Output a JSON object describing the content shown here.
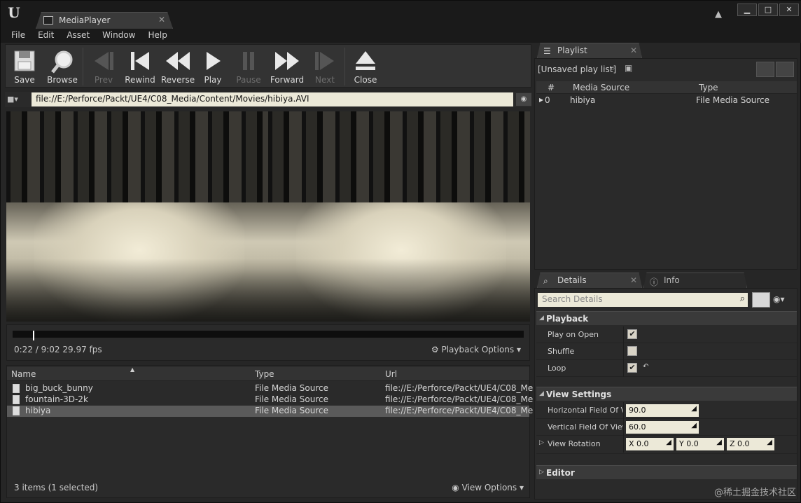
{
  "window": {
    "tab_title": "MediaPlayer"
  },
  "menu": [
    "File",
    "Edit",
    "Asset",
    "Window",
    "Help"
  ],
  "toolbar": {
    "buttons": [
      {
        "label": "Save",
        "enabled": true
      },
      {
        "label": "Browse",
        "enabled": true
      },
      {
        "label": "Prev",
        "enabled": false
      },
      {
        "label": "Rewind",
        "enabled": true
      },
      {
        "label": "Reverse",
        "enabled": true
      },
      {
        "label": "Play",
        "enabled": true
      },
      {
        "label": "Pause",
        "enabled": false
      },
      {
        "label": "Forward",
        "enabled": true
      },
      {
        "label": "Next",
        "enabled": false
      },
      {
        "label": "Close",
        "enabled": true
      }
    ]
  },
  "url": {
    "value": "file://E:/Perforce/Packt/UE4/C08_Media/Content/Movies/hibiya.AVI"
  },
  "playback": {
    "time": "0:22 / 9:02  29.97 fps",
    "progress_fraction": 0.04,
    "options_label": "Playback Options"
  },
  "media_list": {
    "columns": [
      "Name",
      "Type",
      "Url"
    ],
    "rows": [
      {
        "name": "big_buck_bunny",
        "type": "File Media Source",
        "url": "file://E:/Perforce/Packt/UE4/C08_Me",
        "selected": false
      },
      {
        "name": "fountain-3D-2k",
        "type": "File Media Source",
        "url": "file://E:/Perforce/Packt/UE4/C08_Me",
        "selected": false
      },
      {
        "name": "hibiya",
        "type": "File Media Source",
        "url": "file://E:/Perforce/Packt/UE4/C08_Me",
        "selected": true
      }
    ],
    "footer_count": "3 items (1 selected)",
    "view_options": "View Options"
  },
  "playlist": {
    "tab": "Playlist",
    "title": "[Unsaved play list]",
    "columns": [
      "#",
      "Media Source",
      "Type"
    ],
    "rows": [
      {
        "index": "0",
        "source": "hibiya",
        "type": "File Media Source"
      }
    ]
  },
  "details": {
    "tabs": [
      "Details",
      "Info"
    ],
    "search_placeholder": "Search Details",
    "playback_section": "Playback",
    "play_on_open": {
      "label": "Play on Open",
      "checked": true
    },
    "shuffle": {
      "label": "Shuffle",
      "checked": false
    },
    "loop": {
      "label": "Loop",
      "checked": true
    },
    "view_section": "View Settings",
    "hfov": {
      "label": "Horizontal Field Of Vi",
      "value": "90.0"
    },
    "vfov": {
      "label": "Vertical Field Of View",
      "value": "60.0"
    },
    "rotation": {
      "label": "View Rotation",
      "x": "X  0.0",
      "y": "Y  0.0",
      "z": "Z  0.0"
    },
    "editor_section": "Editor"
  },
  "watermark": "@稀土掘金技术社区"
}
